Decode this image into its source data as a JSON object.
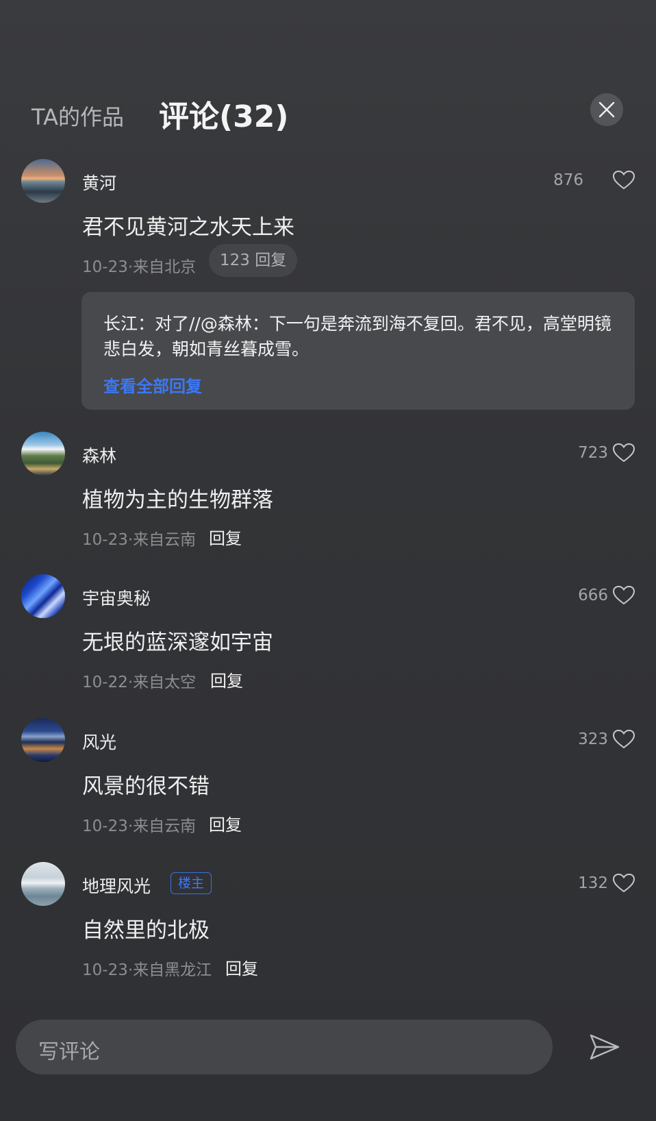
{
  "header": {
    "tab_works": "TA的作品",
    "tab_comments": "评论(32)"
  },
  "comments": [
    {
      "name": "黄河",
      "likes": "876",
      "content": "君不见黄河之水天上来",
      "meta": "10-23·来自北京",
      "reply_count_label": "123 回复",
      "reply_preview": "长江：对了//@森林：下一句是奔流到海不复回。君不见，高堂明镜悲白发，朝如青丝暮成雪。",
      "view_all_replies": "查看全部回复"
    },
    {
      "name": "森林",
      "likes": "723",
      "content": "植物为主的生物群落",
      "meta": "10-23·来自云南",
      "reply_label": "回复"
    },
    {
      "name": "宇宙奥秘",
      "likes": "666",
      "content": "无垠的蓝深邃如宇宙",
      "meta": "10-22·来自太空",
      "reply_label": "回复"
    },
    {
      "name": "风光",
      "likes": "323",
      "content": "风景的很不错",
      "meta": "10-23·来自云南",
      "reply_label": "回复"
    },
    {
      "name": "地理风光",
      "badge": "楼主",
      "likes": "132",
      "content": "自然里的北极",
      "meta": "10-23·来自黑龙江",
      "reply_label": "回复"
    }
  ],
  "input": {
    "placeholder": "写评论"
  },
  "colors": {
    "background": "#333437",
    "accent_blue": "#3c78f5",
    "reply_box": "#48494c"
  },
  "icons": [
    "close-icon",
    "heart-icon",
    "send-icon"
  ]
}
